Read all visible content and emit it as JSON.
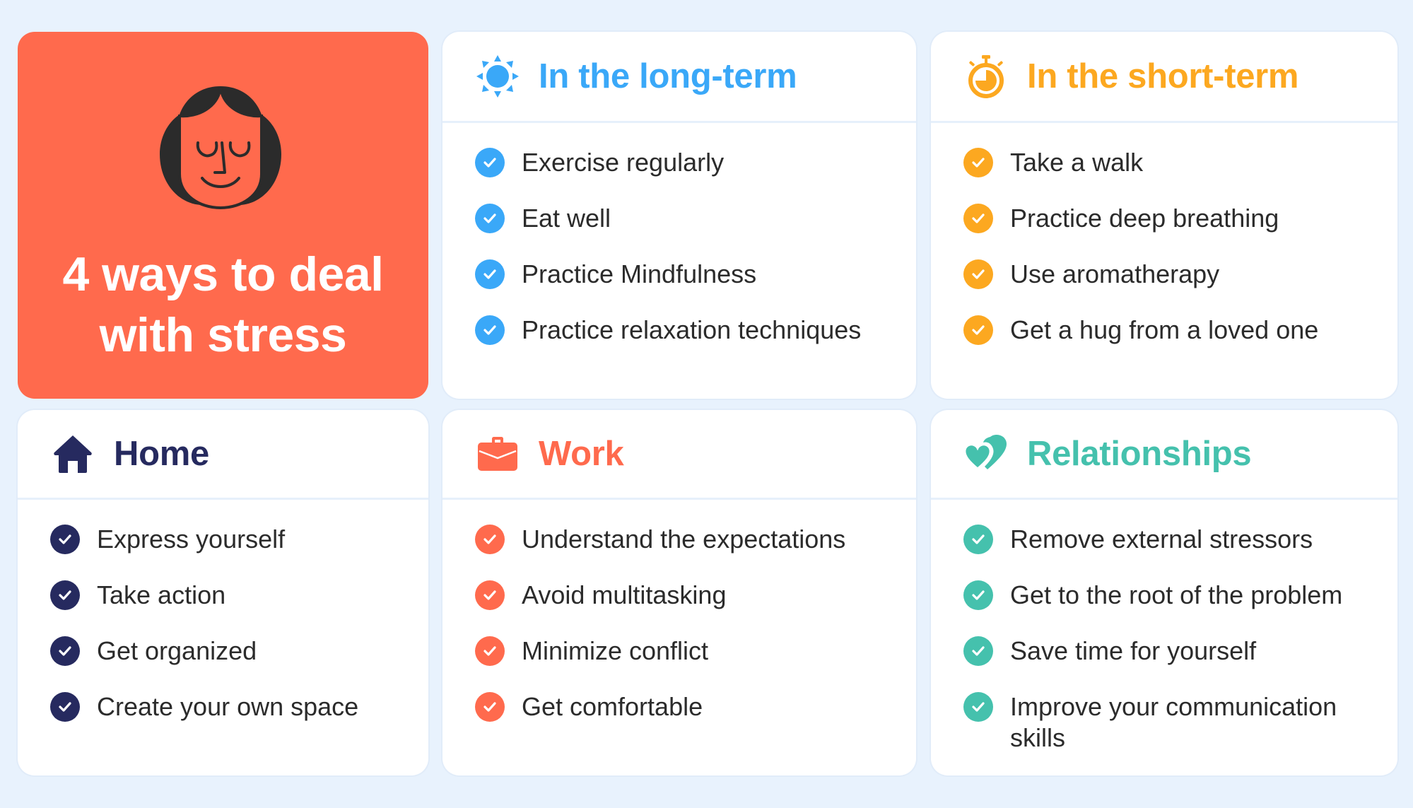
{
  "hero": {
    "title_line1": "4 ways to deal",
    "title_line2": "with stress",
    "illustration": "calm-face-illustration",
    "background_color": "#ff6a4d"
  },
  "cards": [
    {
      "id": "long-term",
      "title": "In the long-term",
      "icon": "sun-icon",
      "accent": "#3aa8f8",
      "items": [
        "Exercise regularly",
        "Eat well",
        "Practice Mindfulness",
        "Practice relaxation techniques"
      ]
    },
    {
      "id": "short-term",
      "title": "In the short-term",
      "icon": "stopwatch-icon",
      "accent": "#fca820",
      "items": [
        "Take a walk",
        "Practice deep breathing",
        "Use aromatherapy",
        "Get a hug from a loved one"
      ]
    },
    {
      "id": "home",
      "title": "Home",
      "icon": "house-icon",
      "accent": "#262a5f",
      "items": [
        "Express yourself",
        "Take action",
        "Get organized",
        "Create your own space"
      ]
    },
    {
      "id": "work",
      "title": "Work",
      "icon": "briefcase-icon",
      "accent": "#ff6a4d",
      "items": [
        "Understand the expectations",
        "Avoid multitasking",
        "Minimize conflict",
        "Get comfortable"
      ]
    },
    {
      "id": "relationships",
      "title": "Relationships",
      "icon": "hearts-icon",
      "accent": "#45c1ad",
      "items": [
        "Remove external stressors",
        "Get to the root of the problem",
        "Save time for yourself",
        "Improve your communication skills"
      ]
    }
  ],
  "colors": {
    "page_background": "#e8f2fd",
    "text": "#2b2b2b",
    "divider": "#e6f0fb"
  }
}
